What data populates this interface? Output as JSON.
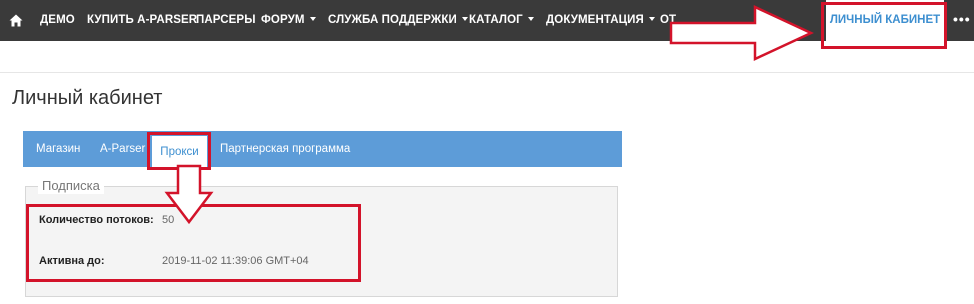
{
  "navbar": {
    "items": [
      {
        "label": "ДЕМО",
        "caret": false
      },
      {
        "label": "КУПИТЬ A-PARSER",
        "caret": false
      },
      {
        "label": "ПАРСЕРЫ",
        "caret": false
      },
      {
        "label": "ФОРУМ",
        "caret": true
      },
      {
        "label": "СЛУЖБА ПОДДЕРЖКИ",
        "caret": true
      },
      {
        "label": "КАТАЛОГ",
        "caret": true
      },
      {
        "label": "ДОКУМЕНТАЦИЯ",
        "caret": true
      },
      {
        "label": "ОТ",
        "caret": false
      }
    ],
    "account": "ЛИЧНЫЙ КАБИНЕТ",
    "more": "•••",
    "icons": {
      "home": "home-icon",
      "more": "more-icon"
    }
  },
  "page": {
    "title": "Личный кабинет"
  },
  "tabs": {
    "items": [
      {
        "label": "Магазин"
      },
      {
        "label": "A-Parser"
      },
      {
        "label": "Прокси"
      },
      {
        "label": "Партнерская программа"
      }
    ],
    "active": "Прокси"
  },
  "subscription": {
    "legend": "Подписка",
    "fields": [
      {
        "label": "Количество потоков:",
        "value": "50"
      },
      {
        "label": "Активна до:",
        "value": "2019-11-02 11:39:06 GMT+04"
      }
    ]
  },
  "colors": {
    "navbar_bg": "#3a3a3a",
    "accent_blue": "#3d8fd0",
    "tabbar_bg": "#5d9cd8",
    "annotation_red": "#d3132a"
  }
}
